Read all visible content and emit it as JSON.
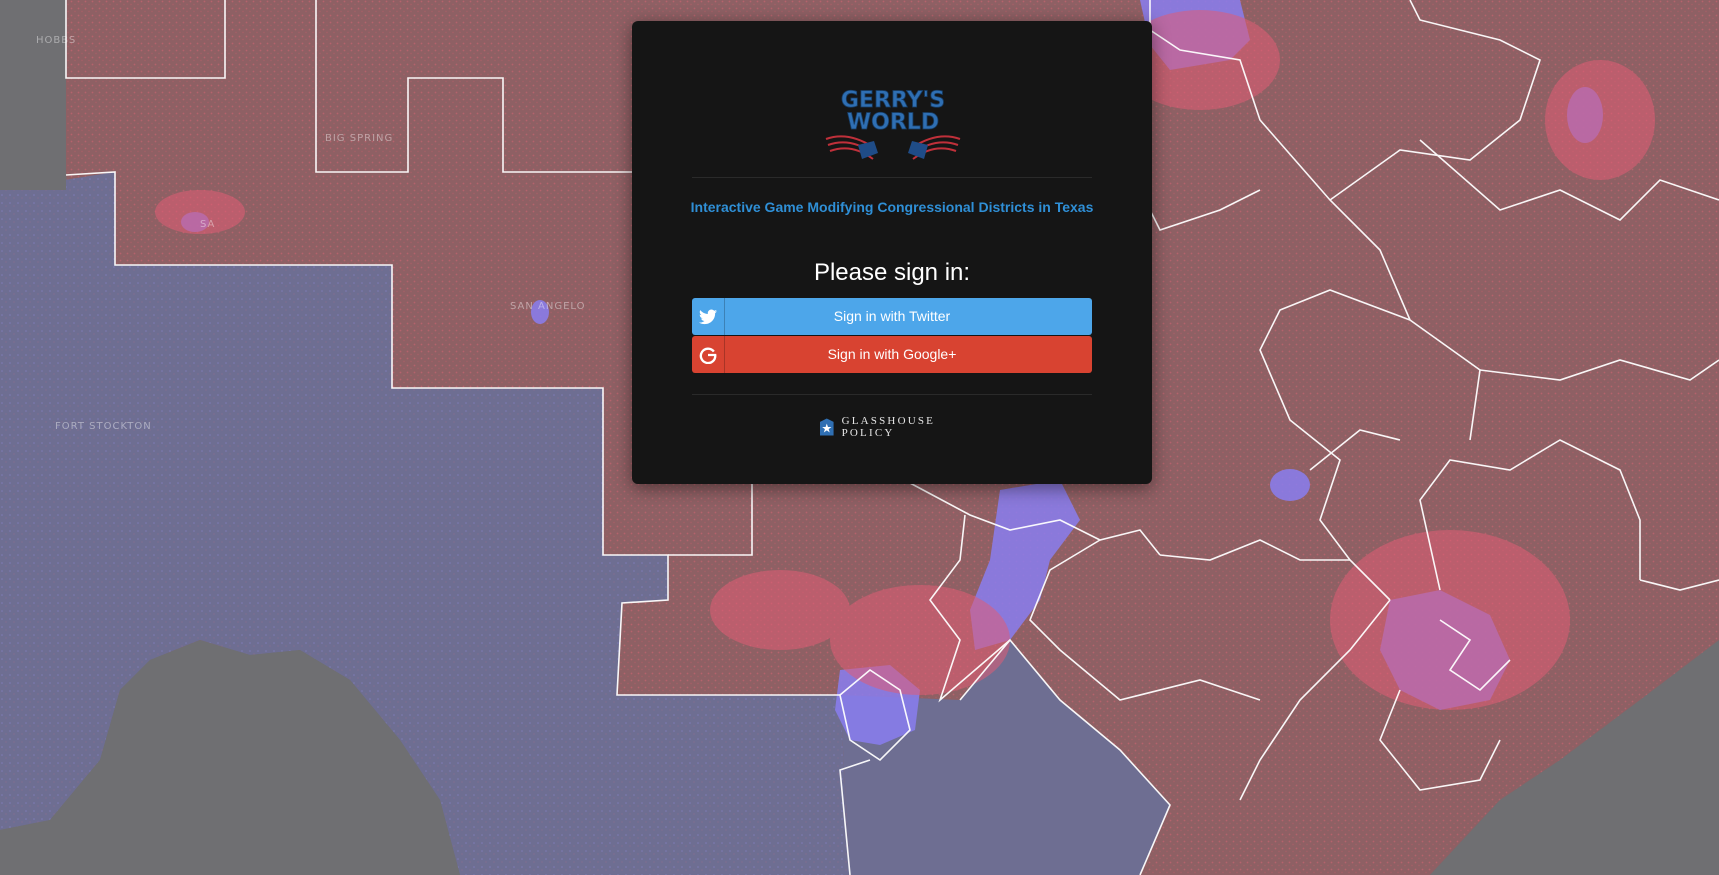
{
  "colors": {
    "modal_bg": "#151515",
    "subtitle": "#2f8fd6",
    "twitter": "#4da6ea",
    "google": "#d84331",
    "republican_district": "#8e6064",
    "democratic_district": "#6e6e92",
    "out_of_state": "#6f6f72"
  },
  "logo": {
    "line1": "GERRY'S",
    "line2": "WORLD"
  },
  "subtitle": "Interactive Game Modifying Congressional Districts in Texas",
  "prompt": "Please sign in:",
  "buttons": {
    "twitter": {
      "label": "Sign in with Twitter",
      "icon": "twitter-icon"
    },
    "google": {
      "label": "Sign in with Google+",
      "icon": "google-icon"
    }
  },
  "footer": {
    "brand": "GLASSHOUSE POLICY",
    "icon": "star-shield-icon"
  },
  "map_labels": [
    "HOBBS",
    "BIG SPRING",
    "SA",
    "SAN ANGELO",
    "FORT STOCKTON"
  ]
}
